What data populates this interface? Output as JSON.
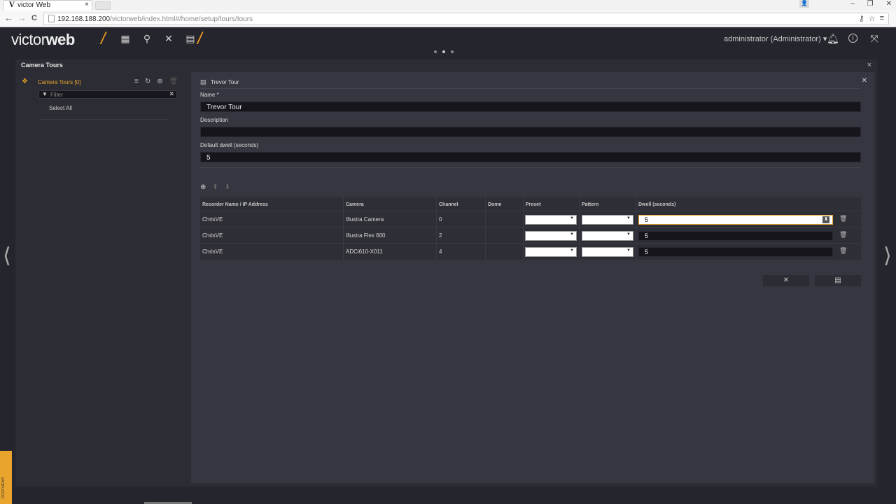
{
  "browser": {
    "favicon": "V",
    "tab_title": "victor Web",
    "tab_close": "×",
    "window_buttons": [
      "–",
      "❐",
      "✕"
    ],
    "url_host": "192.168.188.200",
    "url_path": "/victorweb/index.html#/home/setup/tours/tours",
    "nav_back": "←",
    "nav_forward": "→",
    "nav_reload": "C"
  },
  "app": {
    "logo_light": "victor",
    "logo_bold": "web",
    "slash": "/",
    "user": "administrator (Administrator) ▾",
    "icons": [
      "grid-icon",
      "search-icon",
      "tools-icon",
      "report-icon",
      "bell-icon",
      "info-icon",
      "fullscreen-icon"
    ]
  },
  "panel": {
    "title": "Camera Tours",
    "close": "×"
  },
  "tree": {
    "root_label": "Camera Tours [0]",
    "filter_placeholder": "Filter",
    "select_all": "Select All"
  },
  "editor": {
    "title": "Trevor Tour",
    "name_label": "Name *",
    "name_value": "Trevor Tour",
    "description_label": "Description",
    "description_value": "",
    "dwell_label": "Default dwell (seconds)",
    "dwell_value": "5"
  },
  "table": {
    "headers": [
      "Recorder Name / IP Address",
      "Camera",
      "Channel",
      "Dome",
      "Preset",
      "Pattern",
      "Dwell (seconds)"
    ],
    "rows": [
      {
        "recorder": "ChrisVE",
        "camera": "Illustra Camera",
        "channel": "0",
        "dome": "",
        "dwell": "5"
      },
      {
        "recorder": "ChrisVE",
        "camera": "Illustra Flex 600",
        "channel": "2",
        "dome": "",
        "dwell": "5"
      },
      {
        "recorder": "ChrisVE",
        "camera": "ADCi610-X011",
        "channel": "4",
        "dome": "",
        "dwell": "5"
      }
    ]
  },
  "buttons": {
    "cancel": "✕",
    "save": "💾"
  },
  "dock_label": "DOCKVIEWS"
}
